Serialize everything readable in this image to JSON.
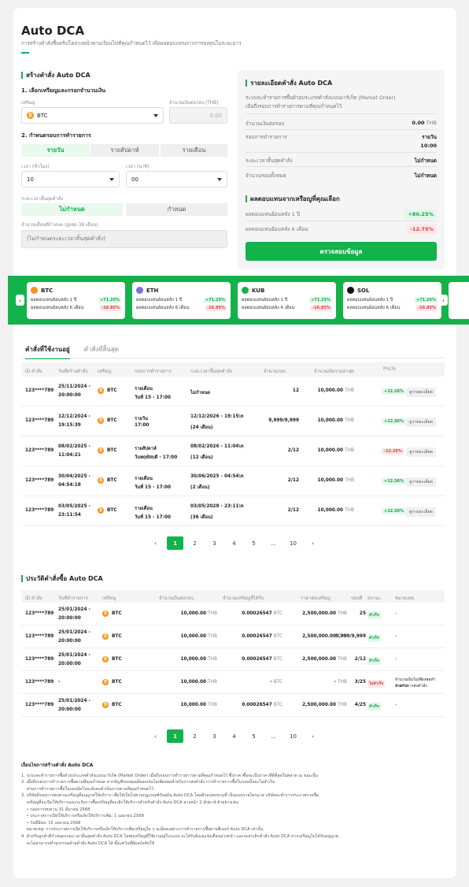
{
  "page": {
    "title": "Auto DCA",
    "subtitle": "การสร้างคำสั่งซื้อคริปโตล่วงหน้าตามเงื่อนไขที่คุณกำหนดไว้ เพื่อผลตอบแทนจากการลงทุนในระยะยาว"
  },
  "create": {
    "heading": "สร้างคำสั่ง Auto DCA",
    "step1": "1. เลือกเหรียญและกรอกจำนวนเงิน",
    "coin_label": "เหรียญ",
    "coin_value": "BTC",
    "amount_label": "จำนวนเงินต่อรอบ (THB)",
    "amount_placeholder": "0.00",
    "step2": "2. กำหนดรอบการทำรายการ",
    "freq_options": [
      "รายวัน",
      "รายสัปดาห์",
      "รายเดือน"
    ],
    "hour_label": "เวลา (ชั่วโมง)",
    "hour_value": "10",
    "minute_label": "เวลา (นาที)",
    "minute_value": "00",
    "end_label": "ระยะเวลาสิ้นสุดคำสั่ง",
    "end_options": [
      "ไม่กำหนด",
      "กำหนด"
    ],
    "months_label": "จำนวนเดือนที่กำหนด (สูงสุด 36 เดือน)",
    "months_placeholder": "(ไม่กำหนดระยะเวลาสิ้นสุดคำสั่ง)"
  },
  "details": {
    "heading": "รายละเอียดคำสั่ง Auto DCA",
    "desc1": "ระบบจะทำรายการซื้อด้วยประเภทคำสั่งแบบมาร์เก็ต (Market Order)",
    "desc2": "เมื่อถึงรอบการทำรายการตามที่คุณกำหนดไว้",
    "rows": [
      {
        "label": "จำนวนเงินต่อรอบ",
        "value": "0.00",
        "unit": "THB"
      },
      {
        "label": "รอบการทำรายการ",
        "value": "รายวัน",
        "value2": "10:00"
      },
      {
        "label": "ระยะเวลาสิ้นสุดคำสั่ง",
        "value": "ไม่กำหนด"
      },
      {
        "label": "จำนวนรอบทั้งหมด",
        "value": "ไม่กำหนด"
      }
    ],
    "returns_heading": "ผลตอบแทนจากเหรียญที่คุณเลือก",
    "return_1y_label": "ผลตอบแทนย้อนหลัง 1 ปี",
    "return_1y": "+80.25%",
    "return_6m_label": "ผลตอบแทนย้อนหลัง 6 เดือน",
    "return_6m": "-12.75%",
    "review_button": "ตรวจสอบข้อมูล"
  },
  "coins": [
    {
      "name": "BTC",
      "icon": "btc-icon",
      "color": "#f7931a",
      "l1": "ผลตอบแทนย้อนหลัง 1 ปี",
      "v1": "+71.25%",
      "l2": "ผลตอบแทนย้อนหลัง 6 เดือน",
      "v2": "-16.85%"
    },
    {
      "name": "ETH",
      "icon": "eth-icon",
      "color": "#7b6fe0",
      "l1": "ผลตอบแทนย้อนหลัง 1 ปี",
      "v1": "+71.25%",
      "l2": "ผลตอบแทนย้อนหลัง 6 เดือน",
      "v2": "-16.85%"
    },
    {
      "name": "KUB",
      "icon": "kub-icon",
      "color": "#13b24b",
      "l1": "ผลตอบแทนย้อนหลัง 1 ปี",
      "v1": "+71.25%",
      "l2": "ผลตอบแทนย้อนหลัง 6 เดือน",
      "v2": "-16.85%"
    },
    {
      "name": "SOL",
      "icon": "sol-icon",
      "color": "#111111",
      "l1": "ผลตอบแทนย้อนหลัง 1 ปี",
      "v1": "+71.25%",
      "l2": "ผลตอบแทนย้อนหลัง 6 เดือน",
      "v2": "-16.85%"
    }
  ],
  "orders": {
    "tabs": [
      "คำสั่งที่ใช้งานอยู่",
      "คำสั่งที่สิ้นสุด"
    ],
    "headers": [
      "ID คำสั่ง",
      "วันที่สร้างคำสั่ง",
      "เหรียญ",
      "รอบการทำรายการ",
      "ระยะเวลาสิ้นสุดคำสั่ง",
      "จำนวนรอบ",
      "จำนวนเงินรวมล่าสุด",
      "PnL%"
    ],
    "detail_label": "ดูรายละเอียด",
    "rows": [
      {
        "id": "123****789",
        "d1": "25/11/2024 -",
        "d2": "20:00:00",
        "coin": "BTC",
        "f1": "รายเดือน",
        "f2": "วันที่ 15 - 17:00",
        "e1": "ไม่กำหนด",
        "e2": "",
        "rounds": "12",
        "total": "10,000.00",
        "unit": "THB",
        "pnl": "+12.26%",
        "pos": true
      },
      {
        "id": "123****789",
        "d1": "12/12/2024 -",
        "d2": "19:15:39",
        "coin": "BTC",
        "f1": "รายวัน",
        "f2": "17:00",
        "e1": "12/12/2026 - 19:15\\n",
        "e2": "(24 เดือน)",
        "rounds": "9,999/9,999",
        "total": "10,000.00",
        "unit": "THB",
        "pnl": "+12.36%",
        "pos": true
      },
      {
        "id": "123****789",
        "d1": "08/02/2025 -",
        "d2": "11:04:21",
        "coin": "BTC",
        "f1": "รายสัปดาห์",
        "f2": "วันพฤหัสบดี - 17:00",
        "e1": "08/02/2026 - 11:04\\n",
        "e2": "(12 เดือน)",
        "rounds": "2/12",
        "total": "10,000.00",
        "unit": "THB",
        "pnl": "-12.26%",
        "pos": false
      },
      {
        "id": "123****789",
        "d1": "30/04/2025 -",
        "d2": "04:54:18",
        "coin": "BTC",
        "f1": "รายเดือน",
        "f2": "วันที่ 15 - 17:00",
        "e1": "30/06/2025 - 04:54\\n",
        "e2": "(2 เดือน)",
        "rounds": "2/12",
        "total": "10,000.00",
        "unit": "THB",
        "pnl": "+12.36%",
        "pos": true
      },
      {
        "id": "123****789",
        "d1": "03/05/2025 -",
        "d2": "23:11:54",
        "coin": "BTC",
        "f1": "รายเดือน",
        "f2": "วันที่ 15 - 17:00",
        "e1": "03/05/2028 - 23:11\\n",
        "e2": "(36 เดือน)",
        "rounds": "2/12",
        "total": "10,000.00",
        "unit": "THB",
        "pnl": "+12.36%",
        "pos": true
      }
    ]
  },
  "pagination": [
    "1",
    "2",
    "3",
    "4",
    "5",
    "...",
    "10"
  ],
  "history": {
    "heading": "ประวัติคำสั่งซื้อ Auto DCA",
    "headers": [
      "ID คำสั่ง",
      "วันที่ทำรายการ",
      "เหรียญ",
      "จำนวนเงินต่อรอบ",
      "จำนวนเหรียญที่ได้รับ",
      "ราคาต่อเหรียญ",
      "รอบที่",
      "สถานะ",
      "หมายเหตุ"
    ],
    "rows": [
      {
        "id": "123****789",
        "d1": "25/01/2024 -",
        "d2": "20:00:00",
        "coin": "BTC",
        "amt": "10,000.00",
        "qty": "0.00026547",
        "price": "2,500,000.00",
        "round": "25",
        "status": "สำเร็จ",
        "ok": true,
        "note": "-"
      },
      {
        "id": "123****789",
        "d1": "25/01/2024 -",
        "d2": "20:00:00",
        "coin": "BTC",
        "amt": "10,000.00",
        "qty": "0.00026547",
        "price": "2,500,000.00",
        "round": "9,999/9,999",
        "status": "สำเร็จ",
        "ok": true,
        "note": "-"
      },
      {
        "id": "123****789",
        "d1": "25/01/2024 -",
        "d2": "20:00:00",
        "coin": "BTC",
        "amt": "10,000.00",
        "qty": "0.00026547",
        "price": "2,500,000.00",
        "round": "2/12",
        "status": "สำเร็จ",
        "ok": true,
        "note": "-"
      },
      {
        "id": "123****789",
        "d1": "-",
        "d2": "",
        "coin": "BTC",
        "amt": "10,000.00",
        "qty": "-",
        "price": "-",
        "round": "3/25",
        "status": "ไม่สำเร็จ",
        "ok": false,
        "note": "จำนวนเงินไม่เพียงพอทำรายการ",
        "note2": "สำหรับการส่งคำสั่ง"
      },
      {
        "id": "123****789",
        "d1": "25/01/2024 -",
        "d2": "20:00:00",
        "coin": "BTC",
        "amt": "10,000.00",
        "qty": "0.00026547",
        "price": "2,500,000.00",
        "round": "4/25",
        "status": "สำเร็จ",
        "ok": true,
        "note": "-"
      }
    ],
    "thb": "THB",
    "btc": "BTC"
  },
  "notes": {
    "heading": "เงื่อนไขการสร้างคำสั่ง Auto DCA",
    "lines": [
      "1. ระบบจะทำรายการซื้อด้วยประเภทคำสั่งแบบมาร์เก็ต (Market Order) เมื่อถึงรอบการทำรายการตามที่คุณกำหนดไว้ ซึ่งราคาซื้อจะเป็นราคาที่ดีที่สุดในตลาด ณ ขณะนั้น",
      "2. เมื่อถึงรอบการทำรายการซื้อตามที่คุณกำหนด หากบัญชีของคุณมียอดเงินไม่เพียงพอสำหรับการส่งคำสั่ง การทำรายการซื้อในรอบนั้นจะไม่สำเร็จ",
      "    ส่วนการทำรายการซื้อในรอบถัดไปจะยังคงดำเนินการตามที่คุณกำหนดไว้",
      "3. บริษัทมีรอบการทบทวนเหรียญที่อนุญาตให้บริการ เพื่อให้เป็นไปตามกฎเกณฑ์ปัจจุบัน Auto DCA โดยมีรอบทบทวนที่ เป็นแบบรายไตรมาส บริษัทจะทำการประกาศรายชื่อ",
      "    เหรียญที่จะเปิดให้บริการและระงับการซื้อเหรียญที่จะเลิกให้บริการสำหรับคำสั่ง Auto DCA ล่วงหน้า 2 สัปดาห์ ตัวอย่างเช่น",
      "    • รอบการทบทวน 31 มีนาคม 2568",
      "    • ประกาศการเปิดให้บริการหรือเลิกให้บริการเพิ่ม: 1 เมษายน 2568",
      "    • วันที่มีผล: 15 เมษายน 2568",
      "    หมายเหตุ: การประกาศการเปิดให้บริการหรือเลิกให้บริการเพิ่มเหรียญใด ๆ จะมีผลเฉพาะการทำรายการซื้อผ่านฟีเจอร์ Auto DCA เท่านั้น",
      "4. สำหรับลูกค้าที่กำหนดระยะเวลาสิ้นสุดคำสั่ง Auto DCA ไม่พบเหรียญที่ใช้งานอยู่ในระบบ จะได้รับอีเมลแจ้งเตือนล่วงหน้า และจะยกเลิกคำสั่ง Auto DCA หากเหรียญไม่ได้รับอนุญาต",
      "    จะไม่สามารถทำธุรกรรมด้วยคำสั่ง Auto DCA ได้ ตั้งแต่วันที่มีผลบังคับใช้"
    ]
  }
}
